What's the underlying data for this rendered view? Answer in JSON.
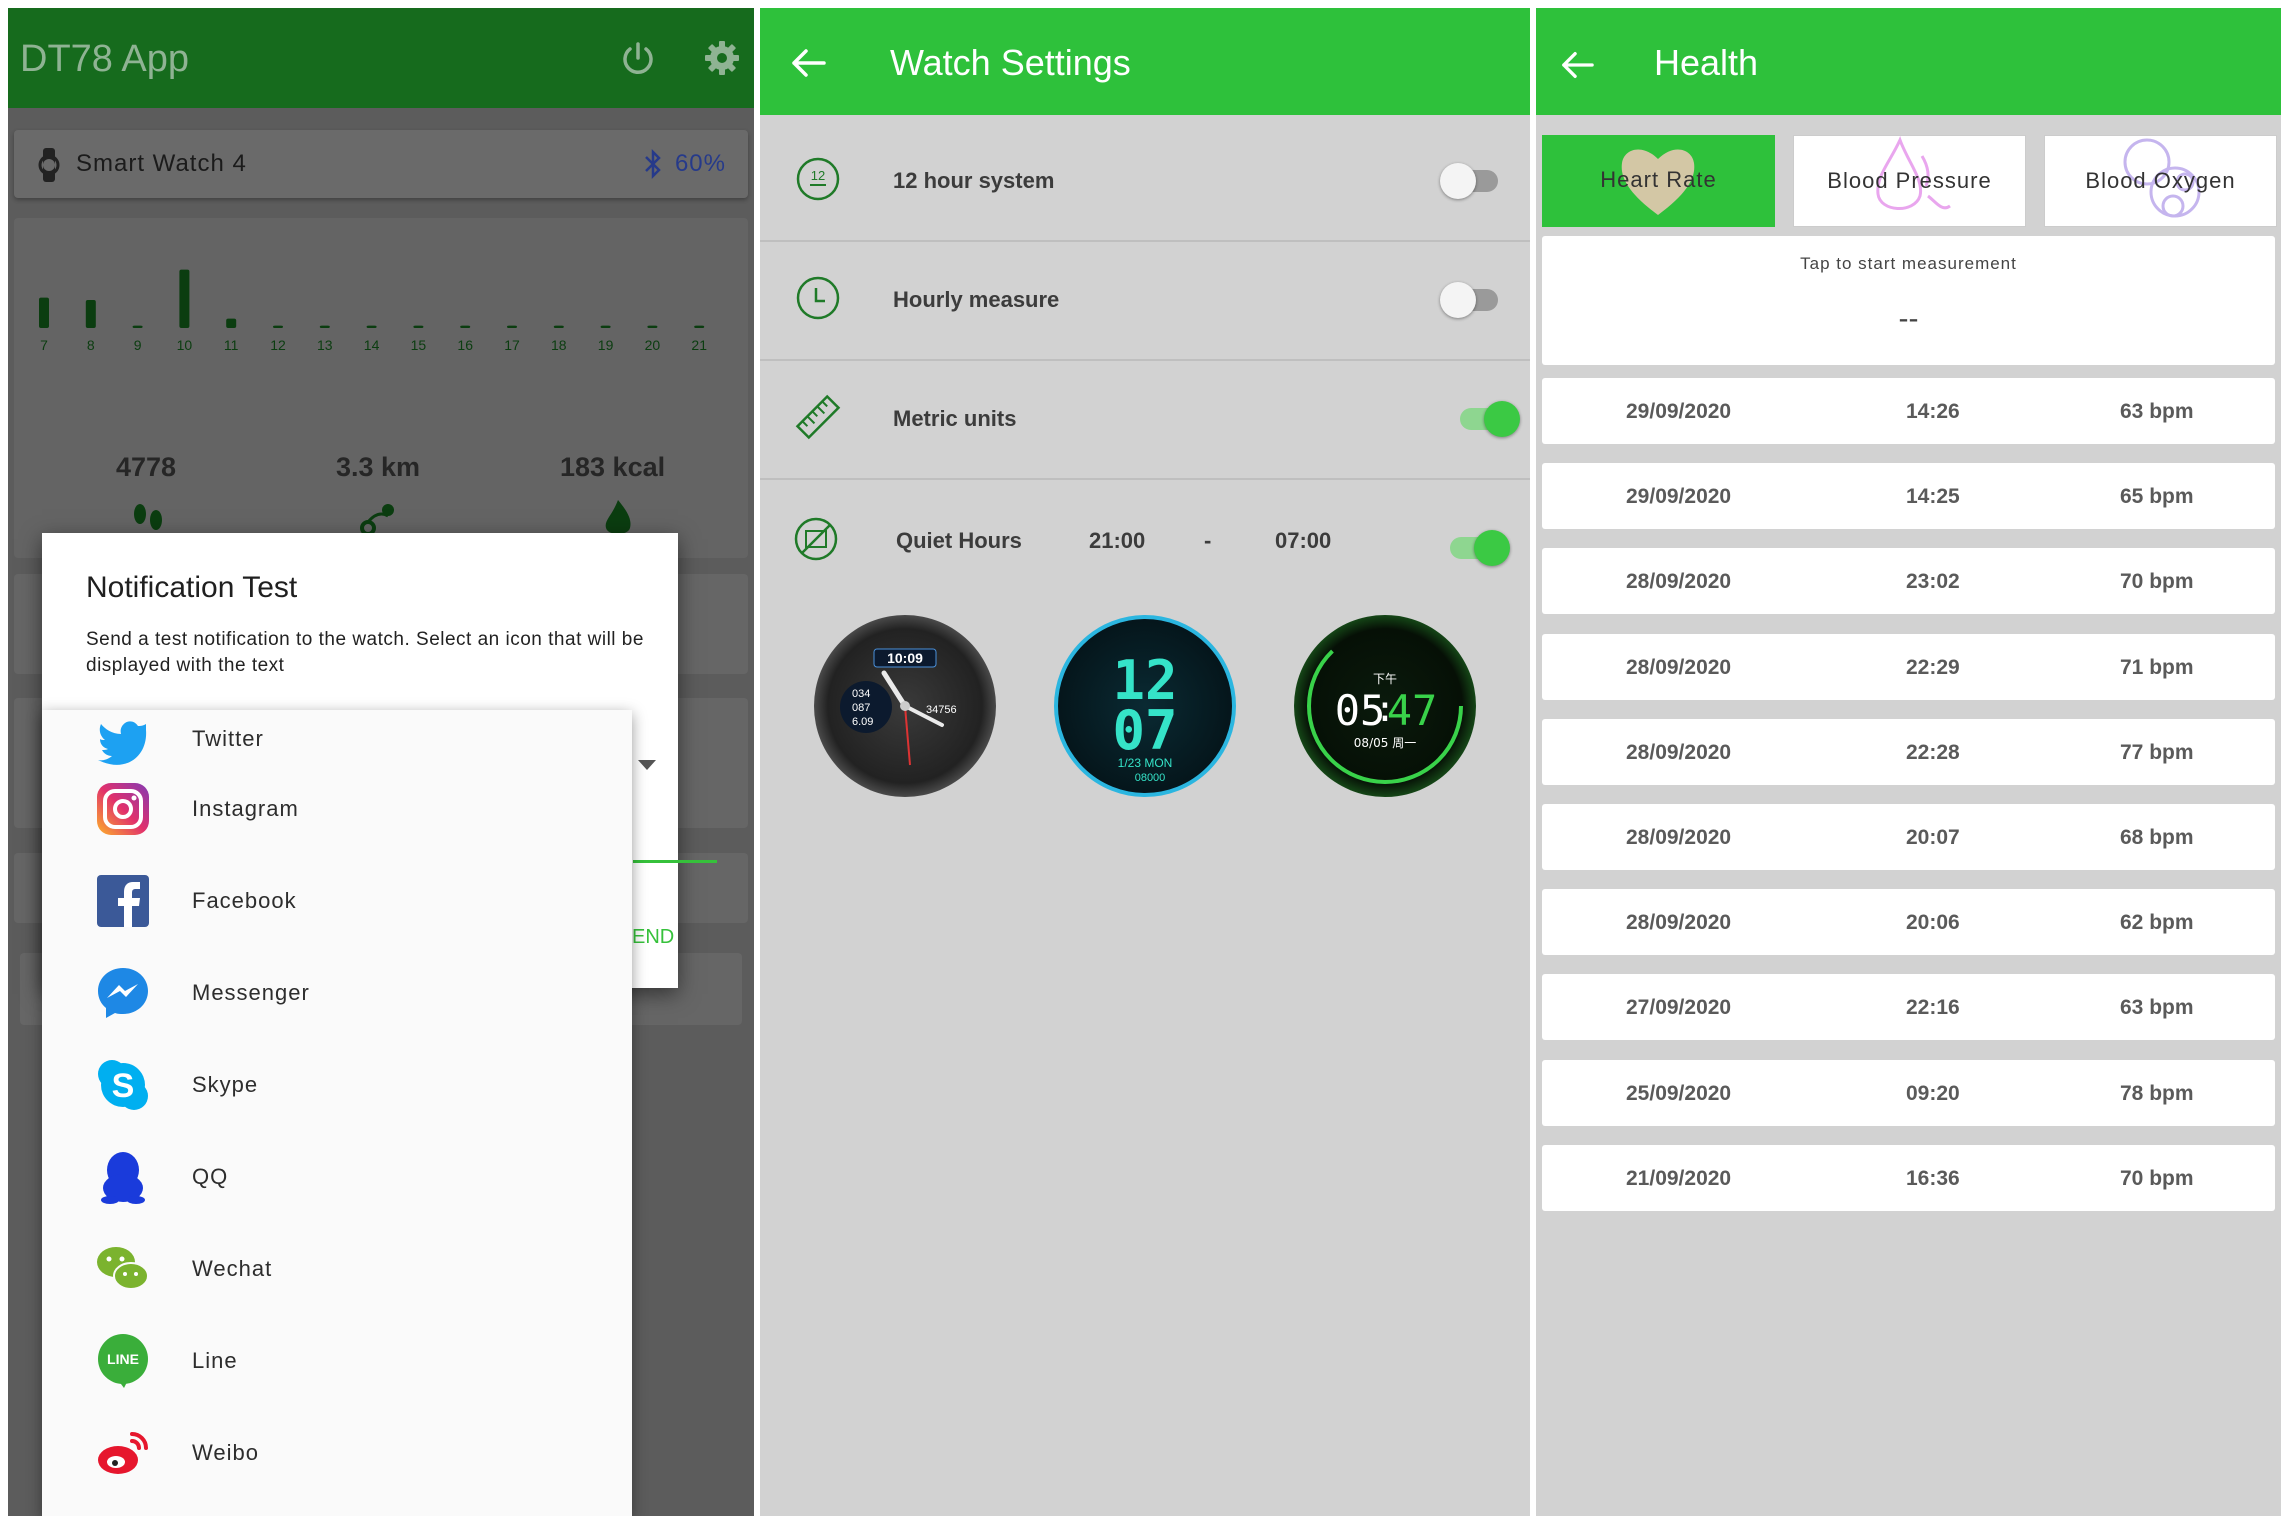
{
  "screen1": {
    "app_title": "DT78 App",
    "device": {
      "name": "Smart Watch 4",
      "battery": "60%"
    },
    "activity": {
      "hours": [
        "7",
        "8",
        "9",
        "10",
        "11",
        "12",
        "13",
        "14",
        "15",
        "16",
        "17",
        "18",
        "19",
        "20",
        "21"
      ],
      "steps": "4778",
      "distance": "3.3 km",
      "calories": "183 kcal"
    },
    "dialog": {
      "title": "Notification Test",
      "text": "Send a test notification to the watch. Select an icon that will be displayed with the text",
      "send_label": "END"
    },
    "dropdown_items": [
      {
        "label": "Twitter"
      },
      {
        "label": "Instagram"
      },
      {
        "label": "Facebook"
      },
      {
        "label": "Messenger"
      },
      {
        "label": "Skype"
      },
      {
        "label": "QQ"
      },
      {
        "label": "Wechat"
      },
      {
        "label": "Line"
      },
      {
        "label": "Weibo"
      }
    ]
  },
  "screen2": {
    "title": "Watch Settings",
    "settings": [
      {
        "label": "12 hour system",
        "enabled": false
      },
      {
        "label": "Hourly measure",
        "enabled": false
      },
      {
        "label": "Metric units",
        "enabled": true
      }
    ],
    "quiet_hours": {
      "label": "Quiet Hours",
      "start": "21:00",
      "separator": "-",
      "end": "07:00",
      "enabled": true
    },
    "watch_faces": [
      {
        "time": "10:09",
        "steps": "34756",
        "lines": [
          "034",
          "087",
          "6.09"
        ]
      },
      {
        "hour": "12",
        "minute": "07",
        "date": "1/23 MON",
        "steps": "08000"
      },
      {
        "ampm": "下午",
        "time_h": "05",
        "time_m": "47",
        "date": "08/05 周一"
      }
    ]
  },
  "screen3": {
    "title": "Health",
    "tabs": [
      {
        "label": "Heart Rate",
        "active": true
      },
      {
        "label": "Blood Pressure",
        "active": false
      },
      {
        "label": "Blood Oxygen",
        "active": false
      }
    ],
    "measure_prompt": "Tap to start measurement",
    "measure_value": "--",
    "records": [
      {
        "date": "29/09/2020",
        "time": "14:26",
        "bpm": "63 bpm"
      },
      {
        "date": "29/09/2020",
        "time": "14:25",
        "bpm": "65 bpm"
      },
      {
        "date": "28/09/2020",
        "time": "23:02",
        "bpm": "70 bpm"
      },
      {
        "date": "28/09/2020",
        "time": "22:29",
        "bpm": "71 bpm"
      },
      {
        "date": "28/09/2020",
        "time": "22:28",
        "bpm": "77 bpm"
      },
      {
        "date": "28/09/2020",
        "time": "20:07",
        "bpm": "68 bpm"
      },
      {
        "date": "28/09/2020",
        "time": "20:06",
        "bpm": "62 bpm"
      },
      {
        "date": "27/09/2020",
        "time": "22:16",
        "bpm": "63 bpm"
      },
      {
        "date": "25/09/2020",
        "time": "09:20",
        "bpm": "78 bpm"
      },
      {
        "date": "21/09/2020",
        "time": "16:36",
        "bpm": "70 bpm"
      }
    ]
  },
  "colors": {
    "primary": "#2ec13b",
    "primary_dark_dimmed": "#166b1d",
    "bar_color": "#0b3d10",
    "active_tab": "#2ec13b"
  },
  "chart_data": {
    "type": "bar",
    "categories": [
      "7",
      "8",
      "9",
      "10",
      "11",
      "12",
      "13",
      "14",
      "15",
      "16",
      "17",
      "18",
      "19",
      "20",
      "21"
    ],
    "values": [
      26,
      24,
      2,
      50,
      8,
      2,
      2,
      2,
      2,
      2,
      2,
      2,
      2,
      2,
      2
    ],
    "ylim": [
      0,
      60
    ],
    "grid": false
  }
}
